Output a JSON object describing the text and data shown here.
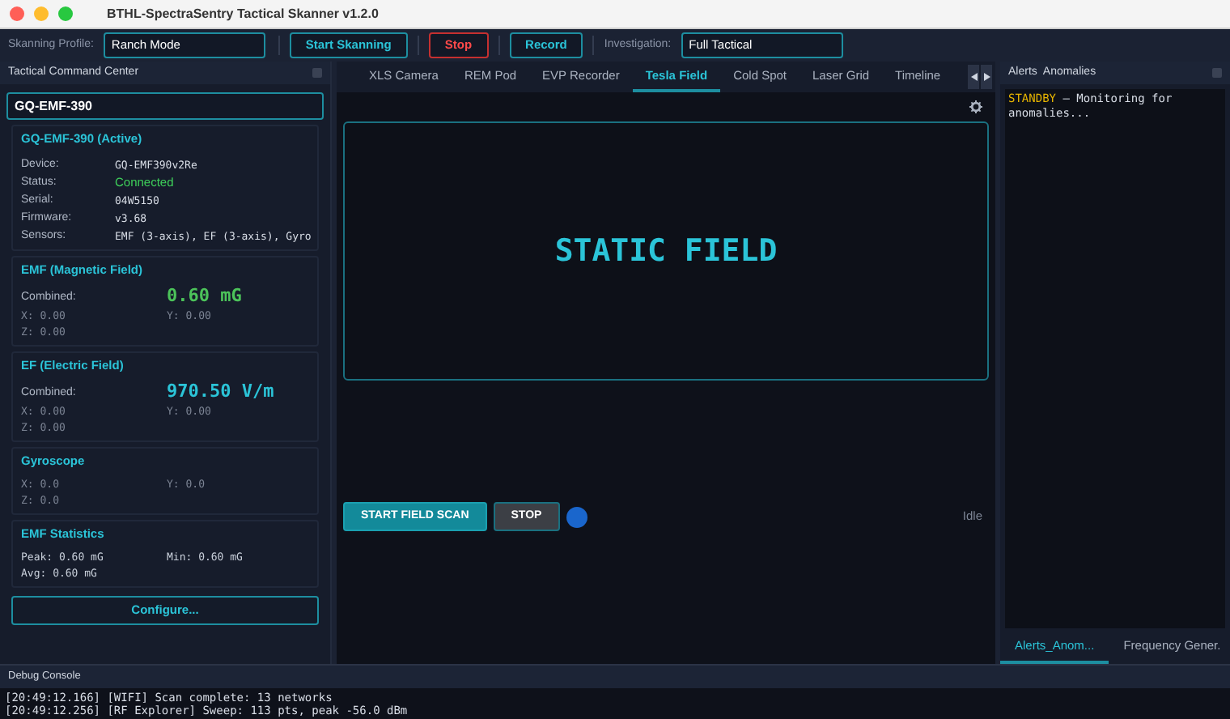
{
  "window": {
    "title": "BTHL-SpectraSentry Tactical Skanner v1.2.0"
  },
  "toolbar": {
    "profile_label": "Skanning Profile:",
    "profile_value": "Ranch Mode",
    "buttons": [
      {
        "label": "Start Skanning",
        "kind": "primary"
      },
      {
        "label": "Stop",
        "kind": "danger"
      },
      {
        "label": "Record",
        "kind": "primary"
      }
    ],
    "investigation_label": "Investigation:",
    "investigation_value": "Full Tactical"
  },
  "left_panel": {
    "title": "Tactical Command Center",
    "device_select": "GQ-EMF-390",
    "device_card": {
      "title": "GQ-EMF-390 (Active)",
      "fields": [
        {
          "label": "Device:",
          "value": "GQ-EMF390v2Re",
          "kind": "text"
        },
        {
          "label": "Status:",
          "value": "Connected",
          "kind": "status"
        },
        {
          "label": "Serial:",
          "value": "04W5150",
          "kind": "text"
        },
        {
          "label": "Firmware:",
          "value": "v3.68",
          "kind": "text"
        },
        {
          "label": "Sensors:",
          "value": "EMF (3-axis), EF (3-axis), Gyro",
          "kind": "text"
        }
      ]
    },
    "sensor_cards": [
      {
        "title": "EMF (Magnetic Field)",
        "combined_label": "Combined:",
        "combined_value": "0.60 mG",
        "kind": "magnetic",
        "readings": [
          "X: 0.00",
          "Y: 0.00",
          "Z: 0.00"
        ]
      },
      {
        "title": "EF (Electric Field)",
        "combined_label": "Combined:",
        "combined_value": "970.50 V/m",
        "kind": "electric",
        "readings": [
          "X: 0.00",
          "Y: 0.00",
          "Z: 0.00"
        ]
      },
      {
        "title": "Gyroscope",
        "kind": "gyro",
        "readings": [
          "X: 0.0",
          "Y: 0.0",
          "Z: 0.0"
        ]
      },
      {
        "title": "EMF Statistics",
        "kind": "stats",
        "readings": [
          "Peak: 0.60 mG",
          "Min: 0.60 mG",
          "Avg: 0.60 mG"
        ]
      }
    ],
    "configure_button": "Configure..."
  },
  "center": {
    "tabs": [
      {
        "label": "XLS Camera",
        "selected": false
      },
      {
        "label": "REM Pod",
        "selected": false
      },
      {
        "label": "EVP Recorder",
        "selected": false
      },
      {
        "label": "Tesla Field",
        "selected": true
      },
      {
        "label": "Cold Spot",
        "selected": false
      },
      {
        "label": "Laser Grid",
        "selected": false
      },
      {
        "label": "Timeline",
        "selected": false
      }
    ],
    "display_text": "STATIC FIELD",
    "scan_button": "START FIELD SCAN",
    "stop_button": "STOP",
    "status": "Idle"
  },
  "right_panel": {
    "title": "Alerts  Anomalies",
    "alert": {
      "level": "STANDBY",
      "message": " – Monitoring for anomalies..."
    },
    "tabs": [
      {
        "label": "Alerts_Anom...",
        "selected": true
      },
      {
        "label": "Frequency Gener.",
        "selected": false
      }
    ]
  },
  "console": {
    "title": "Debug Console",
    "lines": [
      "[20:49:12.166] [WIFI] Scan complete: 13 networks",
      "[20:49:12.256] [RF Explorer] Sweep: 113 pts, peak -56.0 dBm"
    ]
  }
}
